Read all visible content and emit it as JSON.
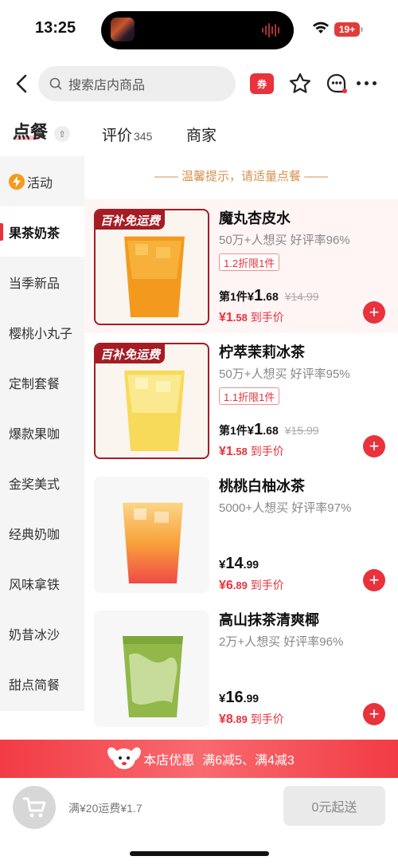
{
  "status": {
    "time": "13:25",
    "battery": "19+"
  },
  "header": {
    "search_placeholder": "搜索店内商品",
    "coupon_label": "券"
  },
  "tabs": {
    "order": "点餐",
    "review": "评价",
    "review_count": "345",
    "merchant": "商家"
  },
  "sidebar": {
    "items": [
      {
        "label": "活动"
      },
      {
        "label": "果茶奶茶"
      },
      {
        "label": "当季新品"
      },
      {
        "label": "樱桃小丸子"
      },
      {
        "label": "定制套餐"
      },
      {
        "label": "爆款果咖"
      },
      {
        "label": "金奖美式"
      },
      {
        "label": "经典奶咖"
      },
      {
        "label": "风味拿铁"
      },
      {
        "label": "奶昔冰沙"
      },
      {
        "label": "甜点简餐"
      }
    ]
  },
  "main": {
    "tip": "—— 温馨提示，请适量点餐 ——",
    "products": [
      {
        "name": "魔丸杏皮水",
        "stats": "50万+人想买  好评率96%",
        "badge": "百补免运费",
        "discount": "1.2折限1件",
        "first_label": "第1件",
        "yen": "¥",
        "price_int": "1",
        "price_dec": ".68",
        "orig": "¥14.99",
        "hand_int": "¥1",
        "hand_dec": ".58",
        "hand_label": " 到手价"
      },
      {
        "name": "柠萃茉莉冰茶",
        "stats": "50万+人想买  好评率95%",
        "badge": "百补免运费",
        "discount": "1.1折限1件",
        "first_label": "第1件",
        "yen": "¥",
        "price_int": "1",
        "price_dec": ".68",
        "orig": "¥15.99",
        "hand_int": "¥1",
        "hand_dec": ".58",
        "hand_label": " 到手价"
      },
      {
        "name": "桃桃白柚冰茶",
        "stats": "5000+人想买  好评率97%",
        "yen": "¥",
        "price_int": "14",
        "price_dec": ".99",
        "hand_int": "¥6",
        "hand_dec": ".89",
        "hand_label": " 到手价"
      },
      {
        "name": "高山抹茶清爽椰",
        "stats": "2万+人想买  好评率96%",
        "yen": "¥",
        "price_int": "16",
        "price_dec": ".99",
        "hand_int": "¥8",
        "hand_dec": ".89",
        "hand_label": " 到手价"
      }
    ]
  },
  "promo": {
    "label": "本店优惠",
    "offers": "满6减5、满4减3"
  },
  "bottom": {
    "fee": "满¥20运费¥1.7",
    "checkout": "0元起送"
  },
  "colors": {
    "accent": "#e8323c",
    "badge": "#a51c24",
    "tip": "#d69150"
  }
}
